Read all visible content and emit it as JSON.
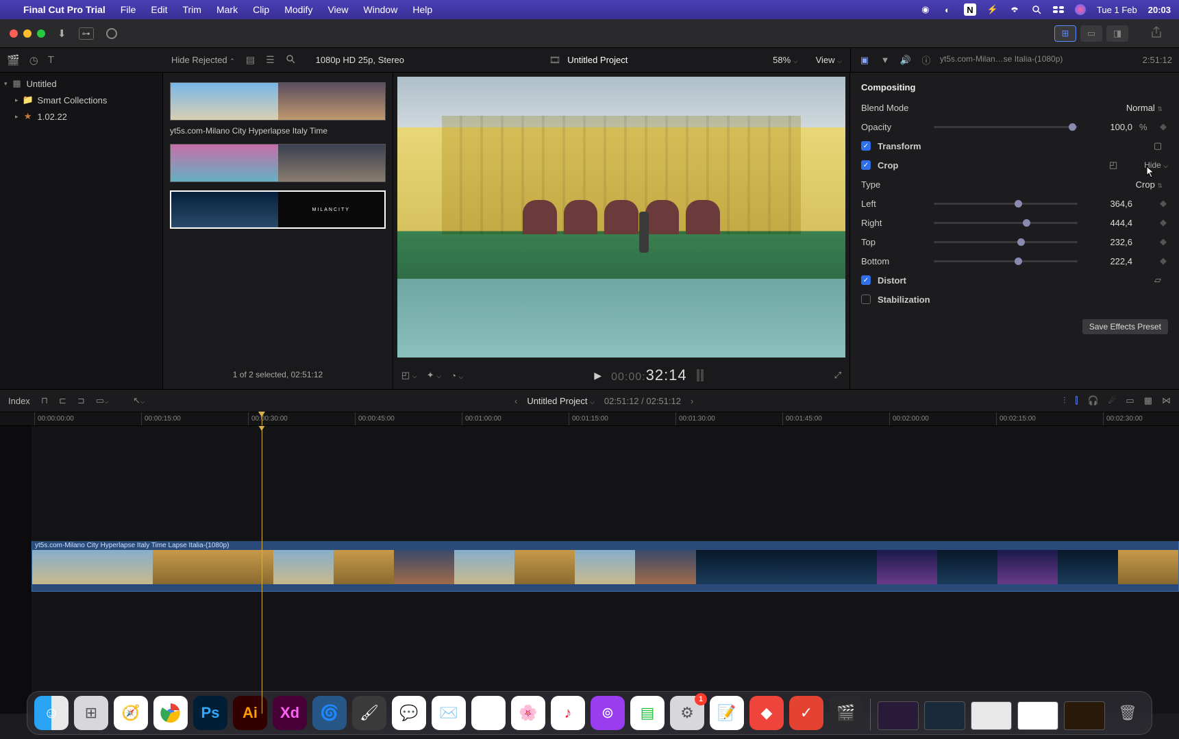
{
  "menubar": {
    "app_name": "Final Cut Pro Trial",
    "items": [
      "File",
      "Edit",
      "Trim",
      "Mark",
      "Clip",
      "Modify",
      "View",
      "Window",
      "Help"
    ],
    "date": "Tue 1 Feb",
    "time": "20:03"
  },
  "library_toolbar": {
    "hide_rejected": "Hide Rejected",
    "viewer_format": "1080p HD 25p, Stereo",
    "project_name": "Untitled Project",
    "zoom": "58%",
    "view_label": "View"
  },
  "inspector_header": {
    "clip_name": "yt5s.com-Milan…se Italia-(1080p)",
    "duration": "2:51:12"
  },
  "sidebar": {
    "items": [
      {
        "label": "Untitled",
        "icon": "▦",
        "expanded": true
      },
      {
        "label": "Smart Collections",
        "icon": "📁",
        "indent": 1
      },
      {
        "label": "1.02.22",
        "icon": "📁",
        "indent": 1
      }
    ]
  },
  "browser": {
    "clip_caption": "yt5s.com-Milano City Hyperlapse Italy Time",
    "milan_title": "MILANCITY",
    "status": "1 of 2 selected, 02:51:12"
  },
  "viewer": {
    "timecode_grey": "00:00:",
    "timecode_main": "32:14"
  },
  "inspector": {
    "compositing": "Compositing",
    "blend_mode_label": "Blend Mode",
    "blend_mode_value": "Normal",
    "opacity_label": "Opacity",
    "opacity_value": "100,0",
    "opacity_unit": "%",
    "transform": "Transform",
    "crop": "Crop",
    "hide": "Hide",
    "type_label": "Type",
    "type_value": "Crop",
    "left_label": "Left",
    "left_value": "364,6",
    "right_label": "Right",
    "right_value": "444,4",
    "top_label": "Top",
    "top_value": "232,6",
    "bottom_label": "Bottom",
    "bottom_value": "222,4",
    "distort": "Distort",
    "stabilization": "Stabilization",
    "save_preset": "Save Effects Preset"
  },
  "timeline_header": {
    "index": "Index",
    "project": "Untitled Project",
    "position": "02:51:12 / 02:51:12"
  },
  "ruler": {
    "ticks": [
      "00:00:00:00",
      "00:00:15:00",
      "00:00:30:00",
      "00:00:45:00",
      "00:01:00:00",
      "00:01:15:00",
      "00:01:30:00",
      "00:01:45:00",
      "00:02:00:00",
      "00:02:15:00",
      "00:02:30:00"
    ]
  },
  "timeline": {
    "clip_label": "yt5s.com-Milano City Hyperlapse Italy Time Lapse Italia-(1080p)"
  },
  "dock": {
    "badge_settings": "1"
  }
}
